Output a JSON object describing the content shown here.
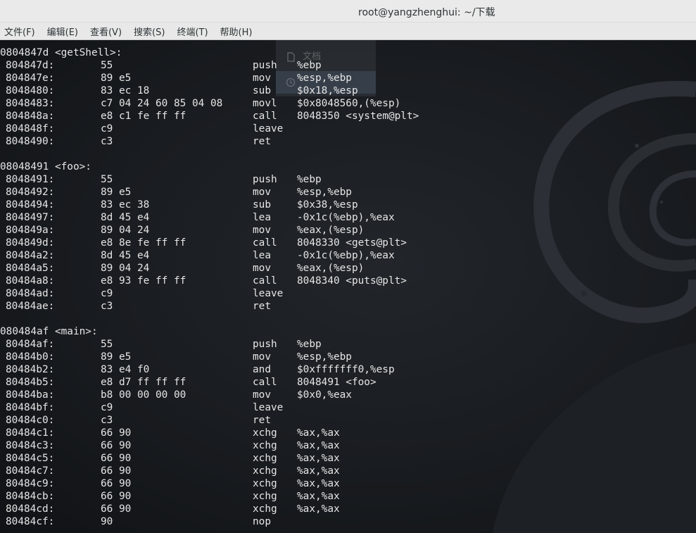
{
  "window": {
    "title": "root@yangzhenghui: ~/下载"
  },
  "menu": [
    {
      "id": "file",
      "label": "文件(F)"
    },
    {
      "id": "edit",
      "label": "编辑(E)"
    },
    {
      "id": "view",
      "label": "查看(V)"
    },
    {
      "id": "search",
      "label": "搜索(S)"
    },
    {
      "id": "terminal",
      "label": "终端(T)"
    },
    {
      "id": "help",
      "label": "帮助(H)"
    }
  ],
  "background_ghost": {
    "items": [
      {
        "label": "文档",
        "icon": "document-icon"
      },
      {
        "label": "",
        "icon": "clock-icon"
      }
    ]
  },
  "terminal": {
    "lines": [
      {
        "type": "label",
        "text": "0804847d <getShell>:"
      },
      {
        "type": "ins",
        "addr": "804847d:",
        "bytes": "55",
        "op": "push",
        "args": "%ebp"
      },
      {
        "type": "ins",
        "addr": "804847e:",
        "bytes": "89 e5",
        "op": "mov",
        "args": "%esp,%ebp"
      },
      {
        "type": "ins",
        "addr": "8048480:",
        "bytes": "83 ec 18",
        "op": "sub",
        "args": "$0x18,%esp"
      },
      {
        "type": "ins",
        "addr": "8048483:",
        "bytes": "c7 04 24 60 85 04 08",
        "op": "movl",
        "args": "$0x8048560,(%esp)"
      },
      {
        "type": "ins",
        "addr": "804848a:",
        "bytes": "e8 c1 fe ff ff",
        "op": "call",
        "args": "8048350 <system@plt>"
      },
      {
        "type": "ins",
        "addr": "804848f:",
        "bytes": "c9",
        "op": "leave",
        "args": ""
      },
      {
        "type": "ins",
        "addr": "8048490:",
        "bytes": "c3",
        "op": "ret",
        "args": ""
      },
      {
        "type": "blank"
      },
      {
        "type": "label",
        "text": "08048491 <foo>:"
      },
      {
        "type": "ins",
        "addr": "8048491:",
        "bytes": "55",
        "op": "push",
        "args": "%ebp"
      },
      {
        "type": "ins",
        "addr": "8048492:",
        "bytes": "89 e5",
        "op": "mov",
        "args": "%esp,%ebp"
      },
      {
        "type": "ins",
        "addr": "8048494:",
        "bytes": "83 ec 38",
        "op": "sub",
        "args": "$0x38,%esp"
      },
      {
        "type": "ins",
        "addr": "8048497:",
        "bytes": "8d 45 e4",
        "op": "lea",
        "args": "-0x1c(%ebp),%eax"
      },
      {
        "type": "ins",
        "addr": "804849a:",
        "bytes": "89 04 24",
        "op": "mov",
        "args": "%eax,(%esp)"
      },
      {
        "type": "ins",
        "addr": "804849d:",
        "bytes": "e8 8e fe ff ff",
        "op": "call",
        "args": "8048330 <gets@plt>"
      },
      {
        "type": "ins",
        "addr": "80484a2:",
        "bytes": "8d 45 e4",
        "op": "lea",
        "args": "-0x1c(%ebp),%eax"
      },
      {
        "type": "ins",
        "addr": "80484a5:",
        "bytes": "89 04 24",
        "op": "mov",
        "args": "%eax,(%esp)"
      },
      {
        "type": "ins",
        "addr": "80484a8:",
        "bytes": "e8 93 fe ff ff",
        "op": "call",
        "args": "8048340 <puts@plt>"
      },
      {
        "type": "ins",
        "addr": "80484ad:",
        "bytes": "c9",
        "op": "leave",
        "args": ""
      },
      {
        "type": "ins",
        "addr": "80484ae:",
        "bytes": "c3",
        "op": "ret",
        "args": ""
      },
      {
        "type": "blank"
      },
      {
        "type": "label",
        "text": "080484af <main>:"
      },
      {
        "type": "ins",
        "addr": "80484af:",
        "bytes": "55",
        "op": "push",
        "args": "%ebp"
      },
      {
        "type": "ins",
        "addr": "80484b0:",
        "bytes": "89 e5",
        "op": "mov",
        "args": "%esp,%ebp"
      },
      {
        "type": "ins",
        "addr": "80484b2:",
        "bytes": "83 e4 f0",
        "op": "and",
        "args": "$0xfffffff0,%esp"
      },
      {
        "type": "ins",
        "addr": "80484b5:",
        "bytes": "e8 d7 ff ff ff",
        "op": "call",
        "args": "8048491 <foo>"
      },
      {
        "type": "ins",
        "addr": "80484ba:",
        "bytes": "b8 00 00 00 00",
        "op": "mov",
        "args": "$0x0,%eax"
      },
      {
        "type": "ins",
        "addr": "80484bf:",
        "bytes": "c9",
        "op": "leave",
        "args": ""
      },
      {
        "type": "ins",
        "addr": "80484c0:",
        "bytes": "c3",
        "op": "ret",
        "args": ""
      },
      {
        "type": "ins",
        "addr": "80484c1:",
        "bytes": "66 90",
        "op": "xchg",
        "args": "%ax,%ax"
      },
      {
        "type": "ins",
        "addr": "80484c3:",
        "bytes": "66 90",
        "op": "xchg",
        "args": "%ax,%ax"
      },
      {
        "type": "ins",
        "addr": "80484c5:",
        "bytes": "66 90",
        "op": "xchg",
        "args": "%ax,%ax"
      },
      {
        "type": "ins",
        "addr": "80484c7:",
        "bytes": "66 90",
        "op": "xchg",
        "args": "%ax,%ax"
      },
      {
        "type": "ins",
        "addr": "80484c9:",
        "bytes": "66 90",
        "op": "xchg",
        "args": "%ax,%ax"
      },
      {
        "type": "ins",
        "addr": "80484cb:",
        "bytes": "66 90",
        "op": "xchg",
        "args": "%ax,%ax"
      },
      {
        "type": "ins",
        "addr": "80484cd:",
        "bytes": "66 90",
        "op": "xchg",
        "args": "%ax,%ax"
      },
      {
        "type": "ins",
        "addr": "80484cf:",
        "bytes": "90",
        "op": "nop",
        "args": ""
      }
    ]
  },
  "colors": {
    "terminal_bg": "#16191d",
    "terminal_fg": "#e6e6e6",
    "titlebar_bg": "#eaeaea",
    "menubar_bg": "#e8e8e8"
  }
}
